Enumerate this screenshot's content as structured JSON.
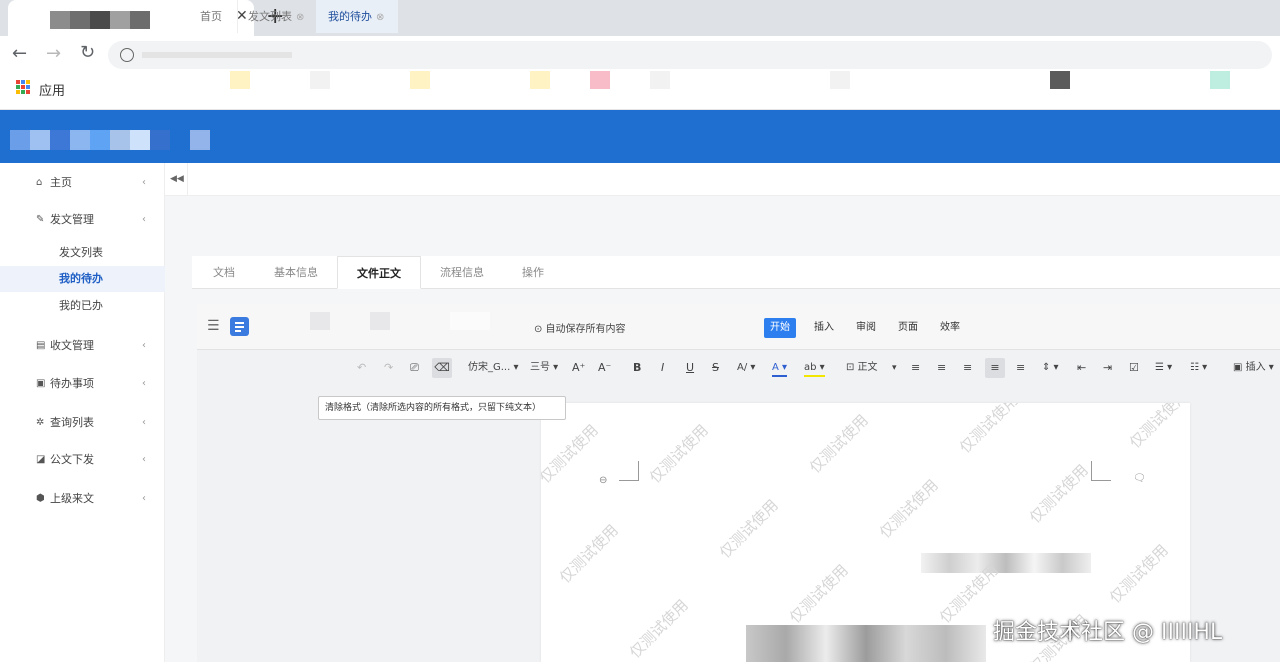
{
  "browser": {
    "tab_close": "✕",
    "new_tab": "+",
    "back": "←",
    "forward": "→",
    "reload": "↻",
    "bookmarks_apps": "应用"
  },
  "sidebar": {
    "items": [
      {
        "icon": "home-icon",
        "glyph": "⌂",
        "label": "主页",
        "chevron": "‹"
      },
      {
        "icon": "edit-icon",
        "glyph": "✎",
        "label": "发文管理",
        "chevron": "‹"
      },
      {
        "icon": "inbox-icon",
        "glyph": "▤",
        "label": "收文管理",
        "chevron": "‹"
      },
      {
        "icon": "todo-icon",
        "glyph": "▣",
        "label": "待办事项",
        "chevron": "‹"
      },
      {
        "icon": "search-list-icon",
        "glyph": "✲",
        "label": "查询列表",
        "chevron": "‹"
      },
      {
        "icon": "publish-icon",
        "glyph": "◪",
        "label": "公文下发",
        "chevron": "‹"
      },
      {
        "icon": "incoming-icon",
        "glyph": "⬢",
        "label": "上级来文",
        "chevron": "‹"
      }
    ],
    "subitems": [
      "发文列表",
      "我的待办",
      "我的已办"
    ]
  },
  "page_tabs": {
    "collapse": "◀◀",
    "items": [
      {
        "label": "首页",
        "close": ""
      },
      {
        "label": "发文列表",
        "close": "⊗"
      },
      {
        "label": "我的待办",
        "close": "⊗"
      }
    ]
  },
  "doc_tabs": [
    "文档",
    "基本信息",
    "文件正文",
    "流程信息",
    "操作"
  ],
  "editor": {
    "autosave": "⊙ 自动保存所有内容",
    "ribbon_tabs": [
      "开始",
      "插入",
      "审阅",
      "页面",
      "效率"
    ],
    "toolbar": {
      "undo": "↶",
      "redo": "↷",
      "format_painter": "⎚",
      "clear_format": "⌫",
      "font_name": "仿宋_G... ▾",
      "font_size": "三号 ▾",
      "grow": "A⁺",
      "shrink": "A⁻",
      "bold": "B",
      "italic": "I",
      "underline": "U",
      "strike": "S",
      "case": "A/ ▾",
      "font_color": "A ▾",
      "highlight": "ab ▾",
      "style": "⊡ 正文",
      "style_caret": "▾",
      "align_left": "≡",
      "align_center": "≡",
      "align_right": "≡",
      "justify": "≡",
      "distribute": "≡",
      "line_spacing": "⇕ ▾",
      "indent_dec": "⇤",
      "indent_inc": "⇥",
      "checkbox": "☑",
      "bullets": "☰ ▾",
      "numbering": "☷ ▾",
      "insert": "▣ 插入 ▾"
    },
    "tooltip": "清除格式（清除所选内容的所有格式，只留下纯文本）",
    "watermark": "仅测试使用"
  },
  "footer_watermark": "掘金技术社区 @ IIIIIHL",
  "colors": {
    "header_blue": "#1f6fd0",
    "accent": "#2d7ff0"
  }
}
